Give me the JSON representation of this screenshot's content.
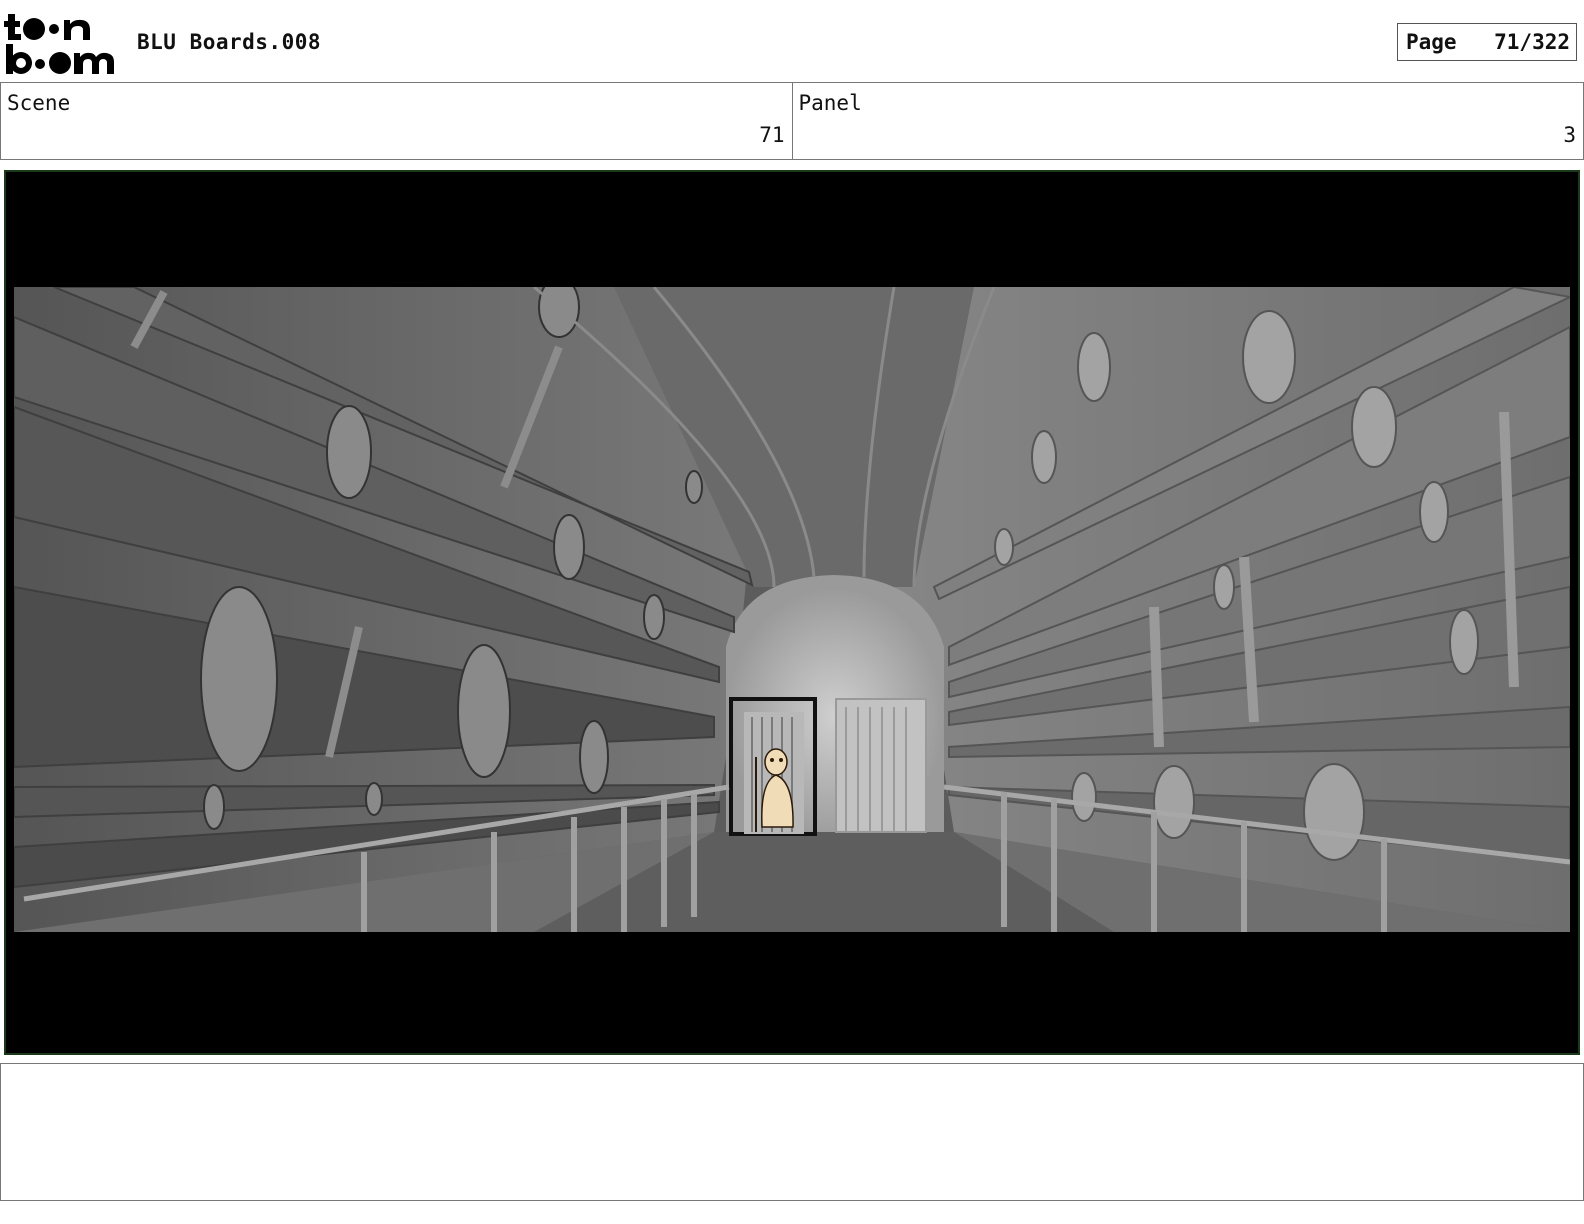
{
  "header": {
    "logo_top": "to•n",
    "logo_bottom": "b••m",
    "project_title": "BLU Boards.008",
    "page_label": "Page",
    "page_value": "71/322"
  },
  "info": {
    "scene_label": "Scene",
    "scene_value": "71",
    "panel_label": "Panel",
    "panel_value": "3"
  },
  "notes": {
    "text": ""
  }
}
